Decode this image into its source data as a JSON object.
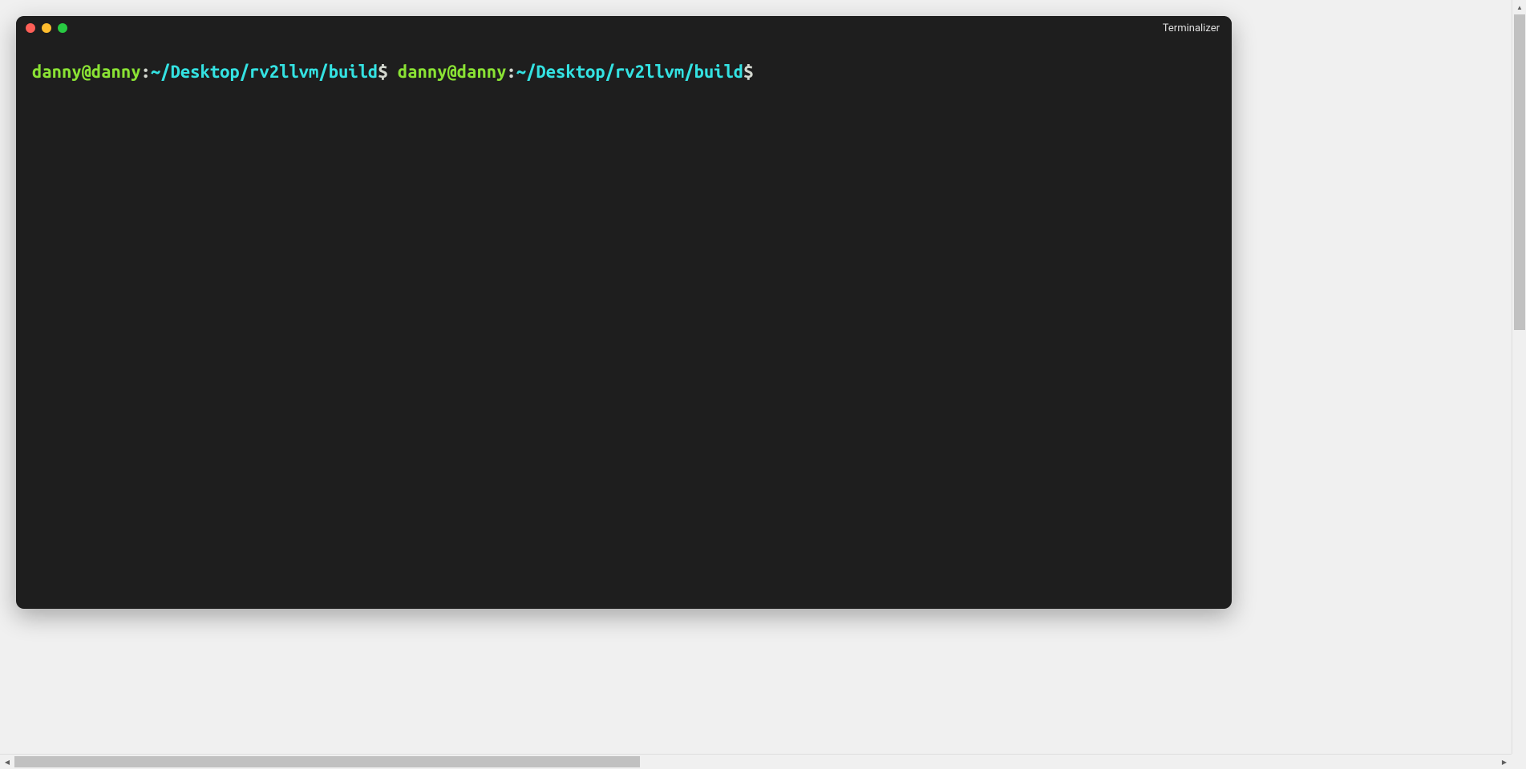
{
  "window": {
    "title": "Terminalizer"
  },
  "terminal": {
    "prompts": [
      {
        "user_host": "danny@danny",
        "colon": ":",
        "path": "~/Desktop/rv2llvm/build",
        "dollar": "$"
      },
      {
        "user_host": "danny@danny",
        "colon": ":",
        "path": "~/Desktop/rv2llvm/build",
        "dollar": "$"
      }
    ]
  },
  "colors": {
    "user_host": "#8ae234",
    "path": "#34e2e2",
    "background": "#1e1e1e",
    "close": "#ff5f57",
    "minimize": "#ffbd2e",
    "maximize": "#28ca42"
  }
}
